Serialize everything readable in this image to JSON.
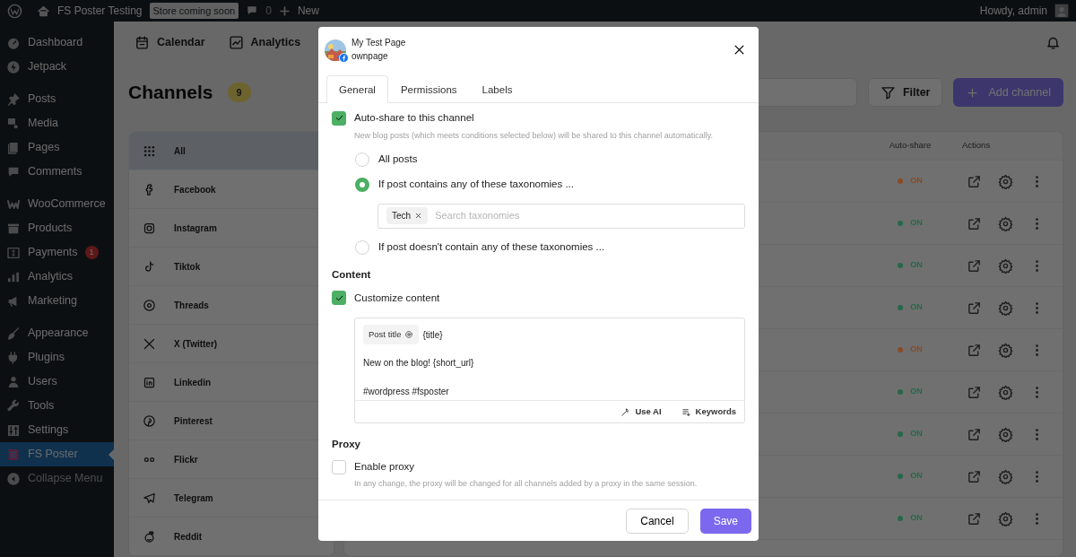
{
  "admin_bar": {
    "site": "FS Poster Testing",
    "store_badge": "Store coming soon",
    "comments": "0",
    "new": "New",
    "greeting": "Howdy, admin"
  },
  "sidebar": {
    "groups": [
      {
        "items": [
          {
            "label": "Dashboard",
            "selected": false
          },
          {
            "label": "Jetpack",
            "selected": false
          }
        ]
      },
      {
        "items": [
          {
            "label": "Posts",
            "selected": false
          },
          {
            "label": "Media",
            "selected": false
          },
          {
            "label": "Pages",
            "selected": false
          },
          {
            "label": "Comments",
            "selected": false
          }
        ]
      },
      {
        "items": [
          {
            "label": "WooCommerce",
            "selected": false
          },
          {
            "label": "Products",
            "selected": false
          },
          {
            "label": "Payments",
            "selected": false,
            "badge": "1"
          },
          {
            "label": "Analytics",
            "selected": false
          },
          {
            "label": "Marketing",
            "selected": false
          }
        ]
      },
      {
        "items": [
          {
            "label": "Appearance",
            "selected": false
          },
          {
            "label": "Plugins",
            "selected": false
          },
          {
            "label": "Users",
            "selected": false
          },
          {
            "label": "Tools",
            "selected": false
          },
          {
            "label": "Settings",
            "selected": false
          },
          {
            "label": "FS Poster",
            "selected": true
          }
        ]
      }
    ],
    "collapse": "Collapse Menu"
  },
  "top_nav": {
    "tabs": [
      {
        "label": "Calendar"
      },
      {
        "label": "Analytics"
      }
    ]
  },
  "page": {
    "title": "Channels",
    "count": "9",
    "filter": "Filter",
    "add": "Add channel"
  },
  "channel_types": [
    {
      "label": "All",
      "selected": true
    },
    {
      "label": "Facebook",
      "selected": false
    },
    {
      "label": "Instagram",
      "selected": false
    },
    {
      "label": "Tiktok",
      "selected": false
    },
    {
      "label": "Threads",
      "selected": false
    },
    {
      "label": "X (Twitter)",
      "selected": false
    },
    {
      "label": "Linkedin",
      "selected": false
    },
    {
      "label": "Pinterest",
      "selected": false
    },
    {
      "label": "Flickr",
      "selected": false
    },
    {
      "label": "Telegram",
      "selected": false
    },
    {
      "label": "Reddit",
      "selected": false
    }
  ],
  "table": {
    "columns": [
      "Auto-share",
      "Actions"
    ],
    "rows": [
      {
        "auto_share": "ON",
        "color": "#8a4a26"
      },
      {
        "auto_share": "ON",
        "color": "#25694a"
      },
      {
        "auto_share": "ON",
        "color": "#25694a"
      },
      {
        "auto_share": "ON",
        "color": "#25694a"
      },
      {
        "auto_share": "ON",
        "color": "#8a4a26"
      },
      {
        "auto_share": "ON",
        "color": "#25694a"
      },
      {
        "auto_share": "ON",
        "color": "#25694a"
      },
      {
        "auto_share": "ON",
        "color": "#25694a"
      },
      {
        "auto_share": "ON",
        "color": "#25694a"
      }
    ]
  },
  "modal": {
    "account": {
      "name": "My Test Page",
      "type": "ownpage"
    },
    "tabs": [
      {
        "label": "General",
        "selected": true
      },
      {
        "label": "Permissions",
        "selected": false
      },
      {
        "label": "Labels",
        "selected": false
      }
    ],
    "auto_share": {
      "label": "Auto-share to this channel",
      "checked": true,
      "hint": "New blog posts (which meets conditions selected below) will be shared to this channel automatically.",
      "options": [
        {
          "label": "All posts",
          "selected": false
        },
        {
          "label": "If post contains any of these taxonomies ...",
          "selected": true,
          "field": {
            "tags": [
              "Tech"
            ],
            "placeholder": "Search taxonomies"
          }
        },
        {
          "label": "If post doesn't contain any of these taxonomies ...",
          "selected": false
        }
      ]
    },
    "content": {
      "heading": "Content",
      "label": "Customize content",
      "checked": true,
      "chip": "Post title",
      "chip_value": "{title}",
      "lines": [
        "New on the blog! {short_url}",
        "#wordpress #fsposter"
      ],
      "actions": [
        "Use AI",
        "Keywords"
      ]
    },
    "proxy": {
      "heading": "Proxy",
      "label": "Enable proxy",
      "checked": false,
      "hint": "In any change, the proxy will be changed for all channels added by a proxy in the same session."
    },
    "buttons": {
      "cancel": "Cancel",
      "save": "Save"
    }
  }
}
